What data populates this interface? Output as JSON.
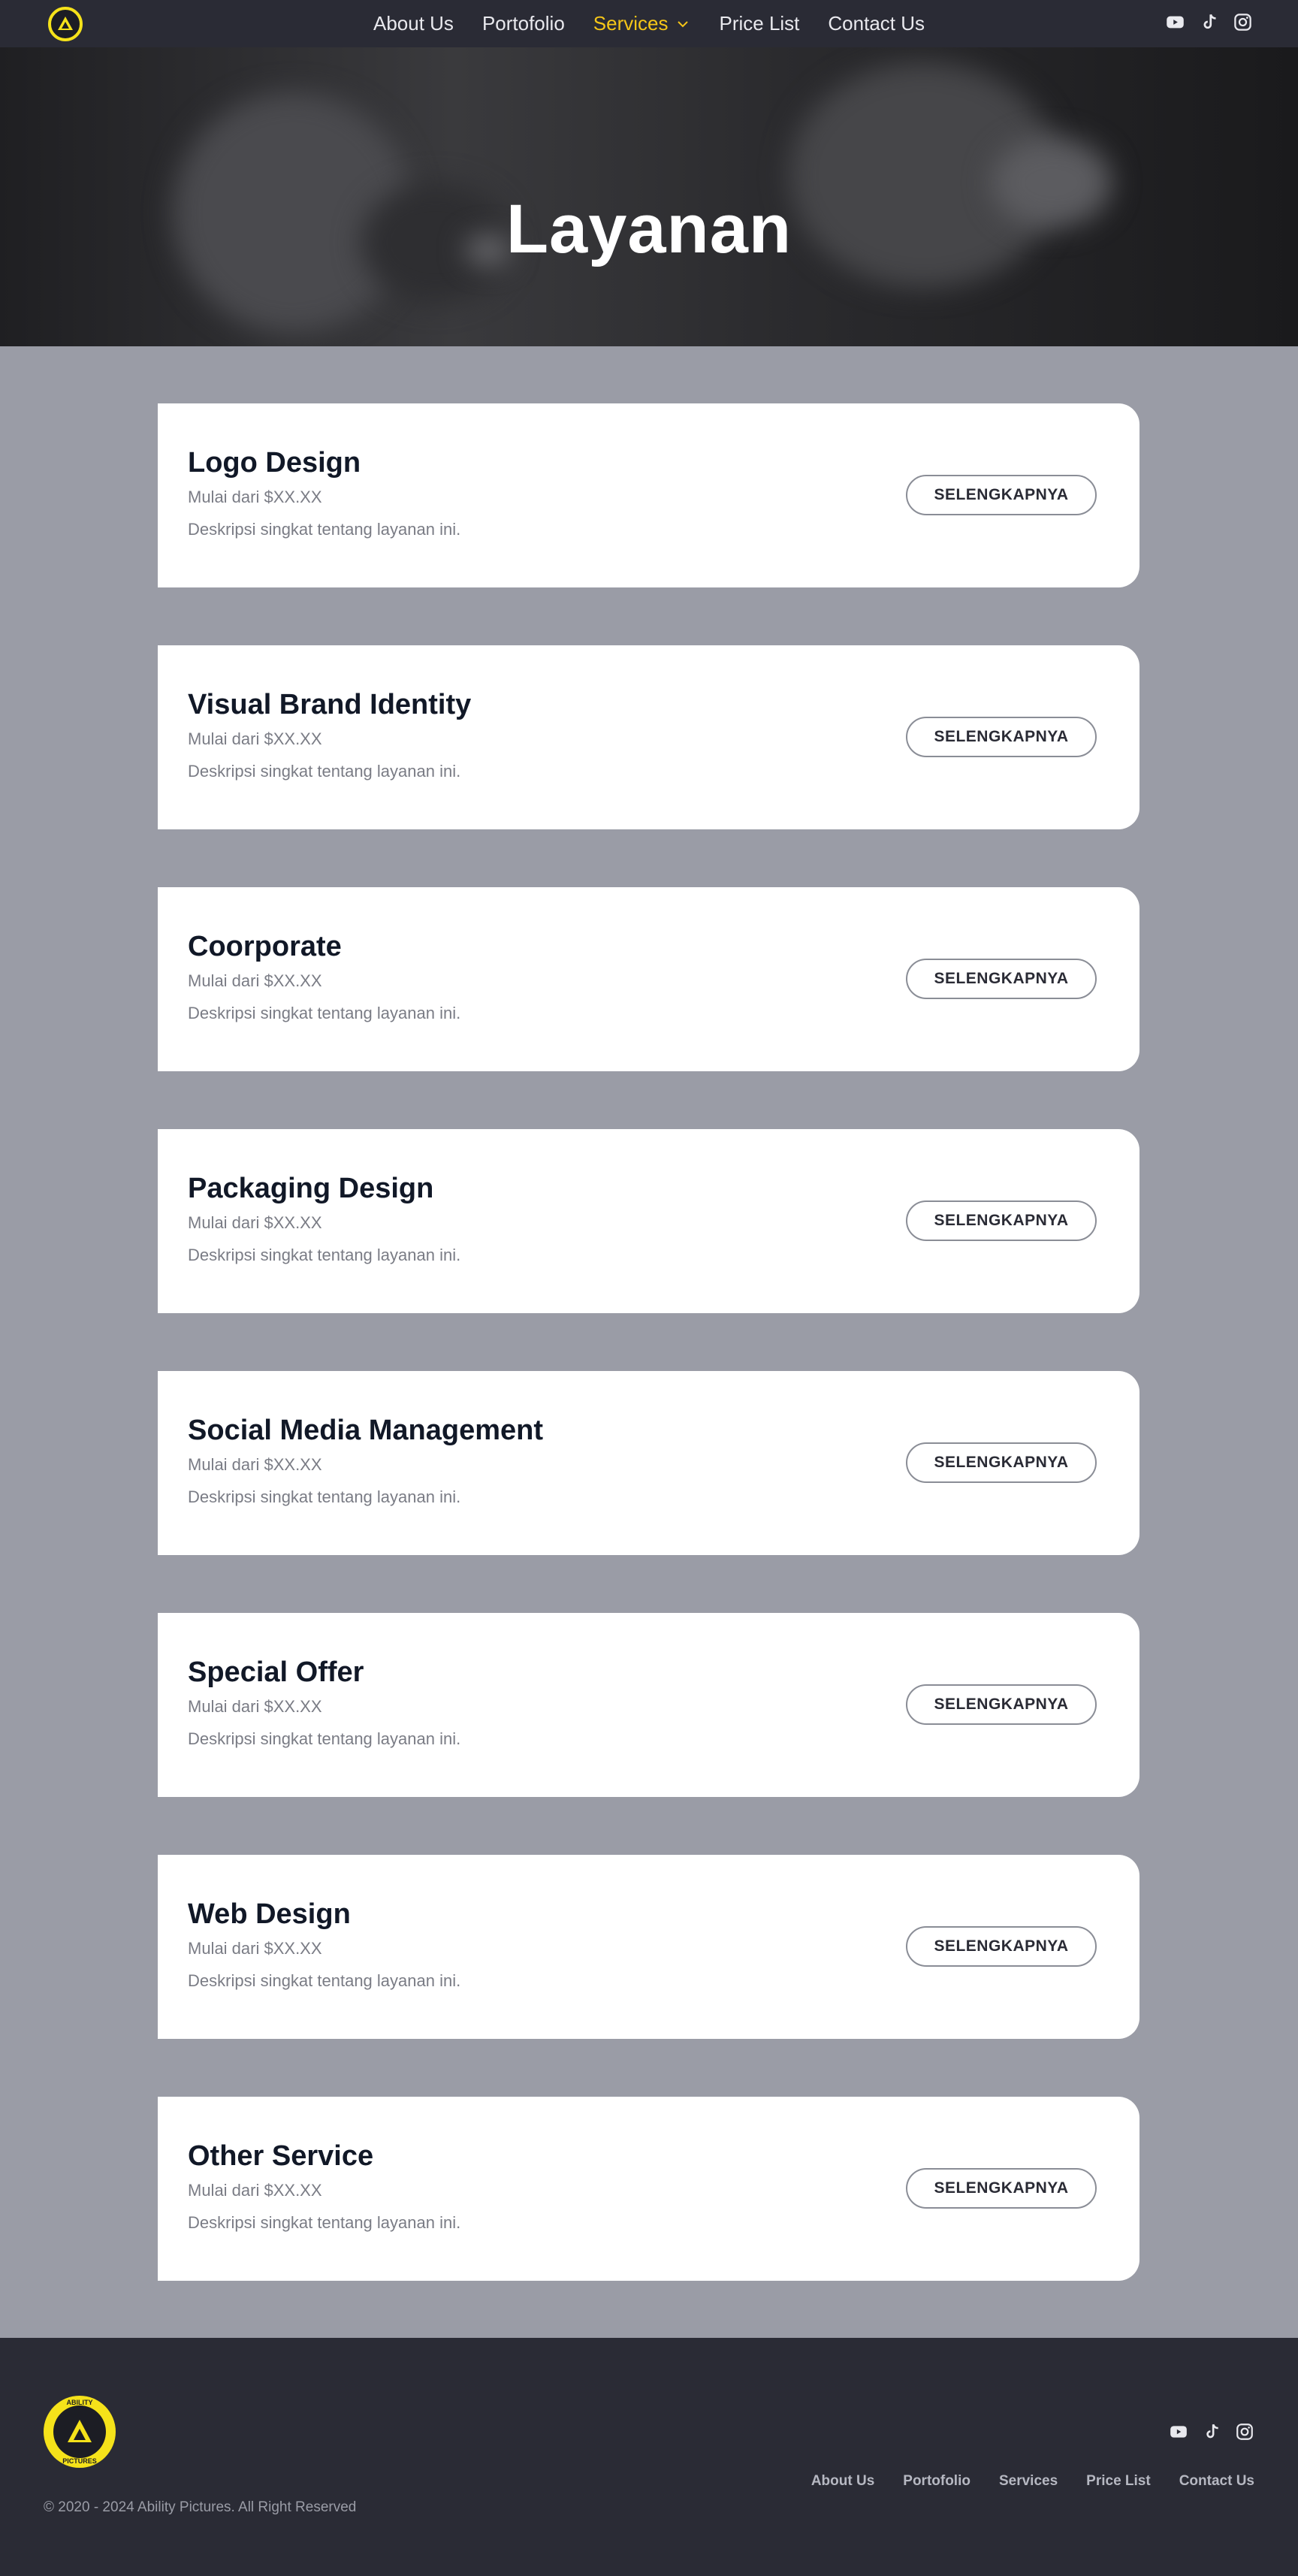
{
  "nav": {
    "links": [
      {
        "label": "About Us"
      },
      {
        "label": "Portofolio"
      },
      {
        "label": "Services"
      },
      {
        "label": "Price List"
      },
      {
        "label": "Contact Us"
      }
    ],
    "active": "Services",
    "icons": [
      "youtube-icon",
      "tiktok-icon",
      "instagram-icon"
    ]
  },
  "hero": {
    "title": "Layanan"
  },
  "services": [
    {
      "title": "Logo Design",
      "price": "Mulai dari $XX.XX",
      "desc": "Deskripsi singkat tentang layanan ini.",
      "button": "SELENGKAPNYA"
    },
    {
      "title": "Visual Brand Identity",
      "price": "Mulai dari $XX.XX",
      "desc": "Deskripsi singkat tentang layanan ini.",
      "button": "SELENGKAPNYA"
    },
    {
      "title": "Coorporate",
      "price": "Mulai dari $XX.XX",
      "desc": "Deskripsi singkat tentang layanan ini.",
      "button": "SELENGKAPNYA"
    },
    {
      "title": "Packaging Design",
      "price": "Mulai dari $XX.XX",
      "desc": "Deskripsi singkat tentang layanan ini.",
      "button": "SELENGKAPNYA"
    },
    {
      "title": "Social Media Management",
      "price": "Mulai dari $XX.XX",
      "desc": "Deskripsi singkat tentang layanan ini.",
      "button": "SELENGKAPNYA"
    },
    {
      "title": "Special Offer",
      "price": "Mulai dari $XX.XX",
      "desc": "Deskripsi singkat tentang layanan ini.",
      "button": "SELENGKAPNYA"
    },
    {
      "title": "Web Design",
      "price": "Mulai dari $XX.XX",
      "desc": "Deskripsi singkat tentang layanan ini.",
      "button": "SELENGKAPNYA"
    },
    {
      "title": "Other Service",
      "price": "Mulai dari $XX.XX",
      "desc": "Deskripsi singkat tentang layanan ini.",
      "button": "SELENGKAPNYA"
    }
  ],
  "footer": {
    "logo_text_top": "ABILITY",
    "logo_text_bottom": "PICTURES",
    "links": [
      {
        "label": "About Us"
      },
      {
        "label": "Portofolio"
      },
      {
        "label": "Services"
      },
      {
        "label": "Price List"
      },
      {
        "label": "Contact Us"
      }
    ],
    "copyright": "© 2020 - 2024 Ability Pictures. All Right Reserved"
  },
  "colors": {
    "nav_bg": "#2a2b35",
    "accent": "#f5c518",
    "logo_yellow": "#f5e21a",
    "page_bg": "#9a9ca6",
    "card_bg": "#ffffff"
  }
}
